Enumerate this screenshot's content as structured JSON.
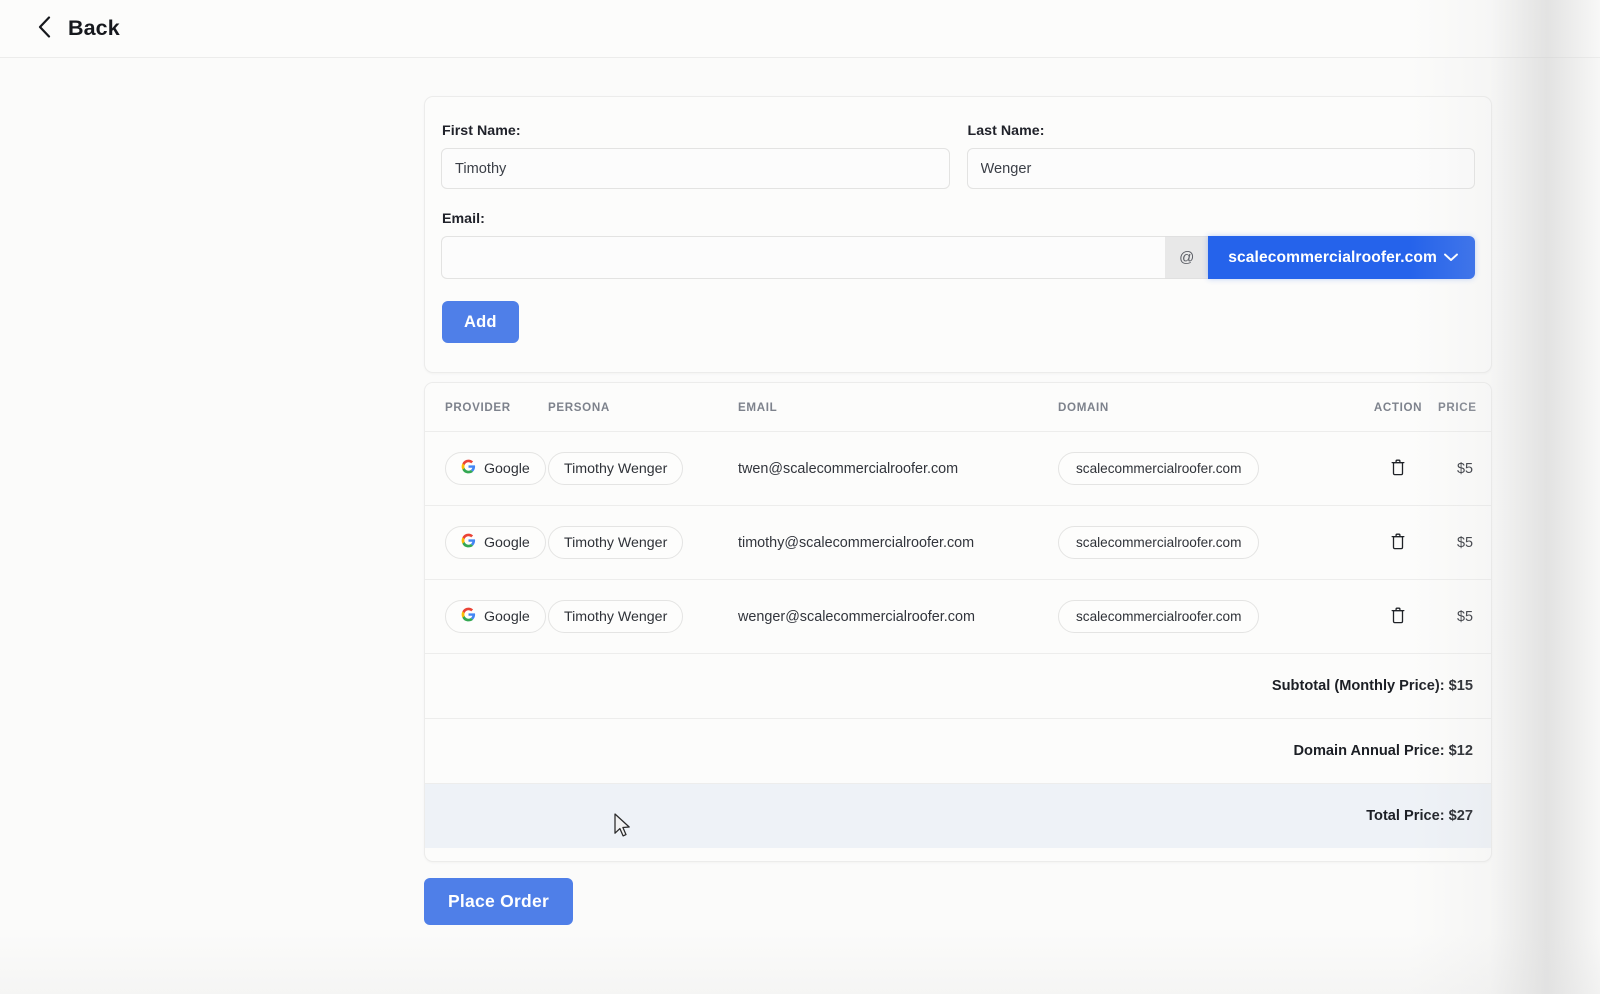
{
  "topbar": {
    "back_label": "Back",
    "back_icon": "chevron-left-icon"
  },
  "form": {
    "first_name": {
      "label": "First Name:",
      "value": "Timothy",
      "placeholder": ""
    },
    "last_name": {
      "label": "Last Name:",
      "value": "Wenger",
      "placeholder": ""
    },
    "email": {
      "label": "Email:",
      "value": "",
      "placeholder": "",
      "at_symbol": "@",
      "domain_selected": "scalecommercialroofer.com",
      "domain_caret_icon": "chevron-down-icon"
    },
    "add_label": "Add"
  },
  "table": {
    "headers": [
      "PROVIDER",
      "PERSONA",
      "EMAIL",
      "DOMAIN",
      "ACTION",
      "PRICE"
    ],
    "rows": [
      {
        "provider": "Google",
        "provider_icon": "google-g-icon",
        "persona": "Timothy Wenger",
        "email": "twen@scalecommercialroofer.com",
        "domain": "scalecommercialroofer.com",
        "action_icon": "trash-icon",
        "price": "$5"
      },
      {
        "provider": "Google",
        "provider_icon": "google-g-icon",
        "persona": "Timothy Wenger",
        "email": "timothy@scalecommercialroofer.com",
        "domain": "scalecommercialroofer.com",
        "action_icon": "trash-icon",
        "price": "$5"
      },
      {
        "provider": "Google",
        "provider_icon": "google-g-icon",
        "persona": "Timothy Wenger",
        "email": "wenger@scalecommercialroofer.com",
        "domain": "scalecommercialroofer.com",
        "action_icon": "trash-icon",
        "price": "$5"
      }
    ],
    "totals": [
      {
        "label": "Subtotal (Monthly Price): $15",
        "emphasis": false
      },
      {
        "label": "Domain Annual Price: $12",
        "emphasis": false
      },
      {
        "label": "Total Price: $27",
        "emphasis": true
      }
    ]
  },
  "footer": {
    "place_order_label": "Place Order"
  },
  "colors": {
    "primary_blue": "#4f7fe8",
    "accent_blue": "#2563eb",
    "page_bg": "#fbfbfa",
    "card_bg": "#fcfcfb",
    "border": "#ececeb",
    "total_row_bg": "#eef2f7",
    "text": "#20222a",
    "muted_text": "#7d828c"
  }
}
